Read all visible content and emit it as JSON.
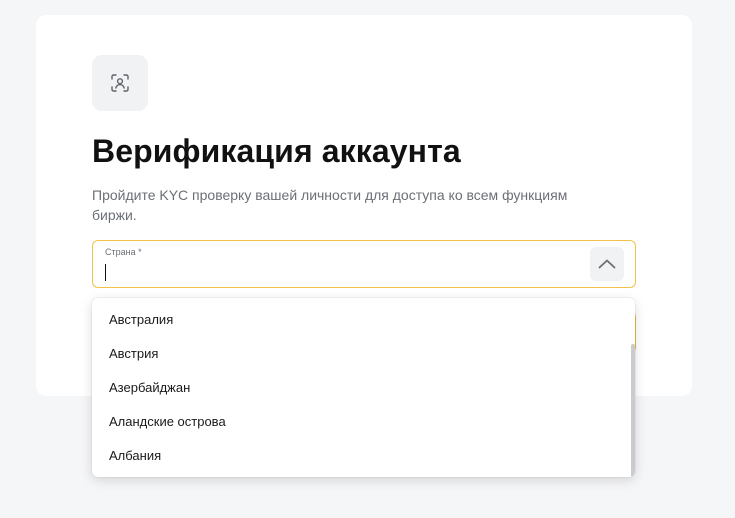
{
  "card": {
    "icon": "face-scan-icon",
    "title": "Верификация аккаунта",
    "subtitle": "Пройдите KYC проверку вашей личности для доступа ко всем функциям биржи."
  },
  "country_field": {
    "label": "Страна *",
    "value": "",
    "toggle_icon": "chevron-up-icon"
  },
  "dropdown": {
    "options": [
      "Австралия",
      "Австрия",
      "Азербайджан",
      "Аландские острова",
      "Албания"
    ]
  },
  "colors": {
    "accent_border": "#f0c24a",
    "background": "#f5f6f8",
    "text_primary": "#111111",
    "text_secondary": "#6b6f76"
  }
}
